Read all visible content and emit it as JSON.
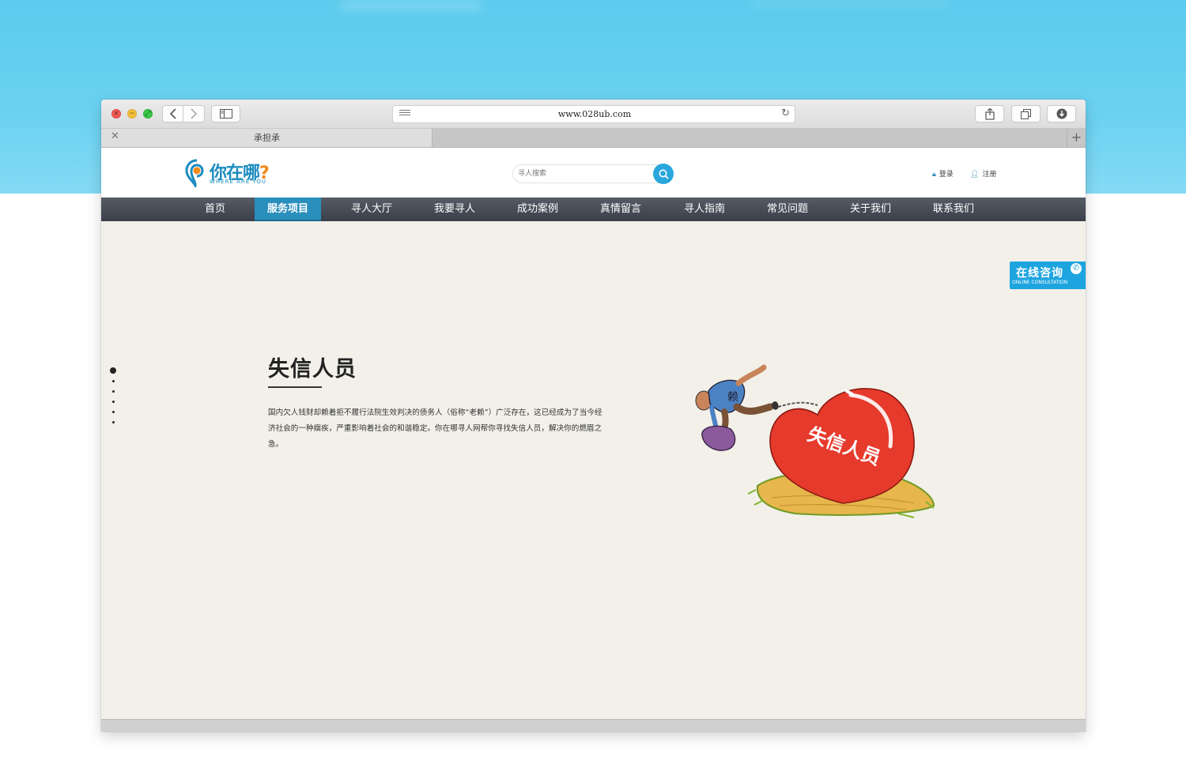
{
  "browser": {
    "url": "www.028ub.com",
    "tab_title": "承担承",
    "new_tab_label": "+"
  },
  "site": {
    "logo_main": "你在哪",
    "logo_mark": "?",
    "logo_sub": "WHERE ARE YOU",
    "search_placeholder": "寻人搜索",
    "login": "登录",
    "register": "注册"
  },
  "nav": {
    "items": [
      "首页",
      "服务项目",
      "寻人大厅",
      "我要寻人",
      "成功案例",
      "真情留言",
      "寻人指南",
      "常见问题",
      "关于我们",
      "联系我们"
    ],
    "active_index": 1
  },
  "content": {
    "title": "失信人员",
    "paragraph": "国内欠人钱财却赖着拒不履行法院生效判决的债务人（俗称“老赖”）广泛存在，这已经成为了当今经济社会的一种痼疾，严重影响着社会的和谐稳定。你在哪寻人网帮你寻找失信人员，解决你的燃眉之急。",
    "illustration_text": "失信人员",
    "illustration_back_text": "赖"
  },
  "consult": {
    "title": "在线咨询",
    "subtitle": "ONLINE CONSULTATION"
  },
  "colors": {
    "accent": "#2b8fbd",
    "nav_bg": "#3a3f49",
    "page_bg": "#f2f0e9",
    "sky": "#5ccbee"
  }
}
